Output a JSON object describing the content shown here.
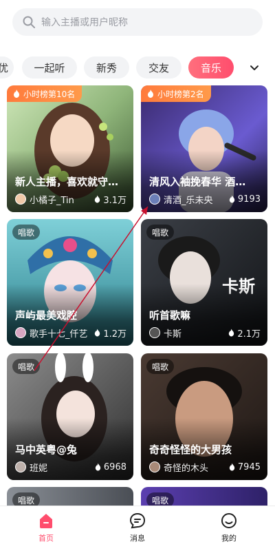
{
  "search": {
    "placeholder": "输入主播或用户昵称"
  },
  "tabs": [
    {
      "label": "优"
    },
    {
      "label": "一起听"
    },
    {
      "label": "新秀"
    },
    {
      "label": "交友"
    },
    {
      "label": "音乐"
    }
  ],
  "cards": [
    {
      "rank": "小时榜第10名",
      "title": "新人主播，喜欢就守…",
      "anchor": "小橘子_Tin",
      "heat": "3.1万"
    },
    {
      "rank": "小时榜第2名",
      "title": "清风入袖挽春华 酒…",
      "anchor": "清酒_乐未央",
      "heat": "9193"
    },
    {
      "category": "唱歌",
      "title": "声屿最美戏腔",
      "anchor": "歌手十七_仟艺",
      "heat": "1.2万"
    },
    {
      "category": "唱歌",
      "title": "听首歌嘛",
      "anchor": "卡斯",
      "heat": "2.1万",
      "art_text": "卡斯"
    },
    {
      "category": "唱歌",
      "title": "马中英粤@兔",
      "anchor": "班妮",
      "heat": "6968"
    },
    {
      "category": "唱歌",
      "title": "奇奇怪怪的大男孩",
      "anchor": "奇怪的木头",
      "heat": "7945"
    },
    {
      "category": "唱歌"
    },
    {
      "category": "唱歌"
    }
  ],
  "nav": [
    {
      "label": "首页",
      "icon": "home-icon",
      "active": true
    },
    {
      "label": "消息",
      "icon": "message-icon",
      "active": false
    },
    {
      "label": "我的",
      "icon": "profile-icon",
      "active": false
    }
  ],
  "colors": {
    "accent": "#ff4d6d",
    "rank_badge": "#ff8a3d"
  }
}
